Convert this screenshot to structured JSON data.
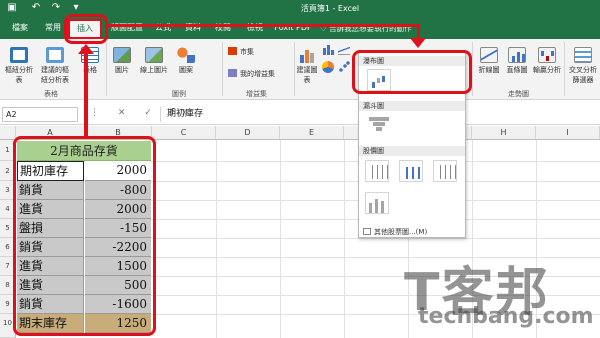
{
  "window": {
    "title": "活頁簿1 - Excel"
  },
  "tabs": [
    "檔案",
    "常用",
    "插入",
    "版面配置",
    "公式",
    "資料",
    "校閱",
    "檢視",
    "Foxit PDF"
  ],
  "tell_me": "告訴我您想要執行的動作",
  "ribbon": {
    "groups": [
      "表格",
      "圖例",
      "增益集",
      "走勢圖"
    ],
    "buttons": {
      "pivot": "樞紐分析表",
      "rec_pivot": "建議的樞紐分析表",
      "table": "表格",
      "pictures": "圖片",
      "online_pictures": "線上圖片",
      "shapes": "圖案",
      "store": "市集",
      "my_addins": "我的增益集",
      "rec_charts": "建議圖表",
      "line_spark": "折線圖",
      "column_spark": "直條圖",
      "winloss_spark": "輸贏分析",
      "slicer": "交叉分析篩選器"
    }
  },
  "formula_bar": {
    "name_box": "A2",
    "icons": "⋮ ✕ ✓ fx",
    "value": "期初庫存"
  },
  "columns": [
    "A",
    "B",
    "C",
    "D",
    "E",
    "F",
    "G",
    "H",
    "I"
  ],
  "rows": [
    "1",
    "2",
    "3",
    "4",
    "5",
    "6",
    "7",
    "8",
    "9",
    "10"
  ],
  "table": {
    "header": "2月商品存貨",
    "rows": [
      {
        "label": "期初庫存",
        "value": "2000"
      },
      {
        "label": "銷貨",
        "value": "-800"
      },
      {
        "label": "進貨",
        "value": "2000"
      },
      {
        "label": "盤損",
        "value": "-150"
      },
      {
        "label": "銷貨",
        "value": "-2200"
      },
      {
        "label": "進貨",
        "value": "1500"
      },
      {
        "label": "進貨",
        "value": "500"
      },
      {
        "label": "銷貨",
        "value": "-1600"
      },
      {
        "label": "期末庫存",
        "value": "1250"
      }
    ]
  },
  "dropdown": {
    "sections": [
      "瀑布圖",
      "漏斗圖",
      "股價圖"
    ],
    "more_link": "其他股票圖...(M)"
  },
  "watermark": {
    "big": "T客邦",
    "small": "techbang.com"
  },
  "colors": {
    "excel_green": "#217346",
    "annotation_red": "#e0101a",
    "header_green": "#a9d08e",
    "total_tan": "#c8ad7a"
  }
}
